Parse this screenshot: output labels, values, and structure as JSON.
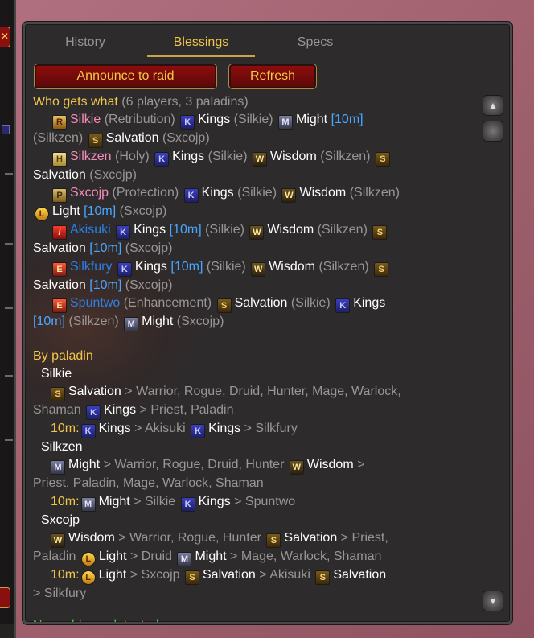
{
  "tabs": [
    "History",
    "Blessings",
    "Specs"
  ],
  "buttons": {
    "announce": "Announce to raid",
    "refresh": "Refresh"
  },
  "heading_who": "Who gets what",
  "heading_who_count": "(6 players, 3 paladins)",
  "heading_by": "By paladin",
  "units": {
    "ten": "[10m]",
    "ten_colon": "10m:"
  },
  "players": {
    "silkie": {
      "name": "Silkie",
      "spec": "(Retribution)"
    },
    "silkzen": {
      "name": "Silkzen",
      "spec": "(Holy)"
    },
    "sxcojp": {
      "name": "Sxcojp",
      "spec": "(Protection)"
    },
    "light_row": {
      "name": "Light"
    },
    "akisuki": {
      "name": "Akisuki"
    },
    "silkfury": {
      "name": "Silkfury"
    },
    "spuntwo": {
      "name": "Spuntwo",
      "spec": "(Enhancement)"
    }
  },
  "blessings": {
    "kings": "Kings",
    "might": "Might",
    "salvation": "Salvation",
    "wisdom": "Wisdom",
    "light": "Light"
  },
  "casters": {
    "silkie": "(Silkie)",
    "silkzen": "(Silkzen)",
    "sxcojp": "(Sxcojp)"
  },
  "by_paladin": {
    "silkie": {
      "name": "Silkie",
      "salv_targets": "> Warrior, Rogue, Druid, Hunter, Mage, Warlock,",
      "salv_targets2": "Shaman",
      "kings_targets": "> Priest, Paladin",
      "ten_kings1": "> Akisuki",
      "ten_kings2": "> Silkfury"
    },
    "silkzen": {
      "name": "Silkzen",
      "might_targets": "> Warrior, Rogue, Druid, Hunter",
      "wis_targets": ">",
      "wis_targets2": "Priest, Paladin, Mage, Warlock, Shaman",
      "ten_might": "> Silkie",
      "ten_kings": "> Spuntwo"
    },
    "sxcojp": {
      "name": "Sxcojp",
      "wis_targets": "> Warrior, Rogue, Hunter",
      "salv_targets": "> Priest,",
      "salv_targets2": "Paladin",
      "light_targets": "> Druid",
      "might_targets": "> Mage, Warlock, Shaman",
      "ten_light": "> Sxcojp",
      "ten_salv1": "> Akisuki",
      "ten_salv2": "> Silkfury"
    }
  },
  "status": "No problems detected.",
  "colors": {
    "accent_gold": "#f0c64a",
    "paladin_pink": "#f48cba",
    "shaman_blue": "#2e7fe6",
    "ten_blue": "#4aa6ff",
    "ok_green": "#48c24a",
    "button_red": "#8c0d0d"
  },
  "icons": {
    "kings": "kings-blessing-icon",
    "might": "might-blessing-icon",
    "salvation": "salvation-blessing-icon",
    "wisdom": "wisdom-blessing-icon",
    "light": "light-blessing-icon"
  }
}
